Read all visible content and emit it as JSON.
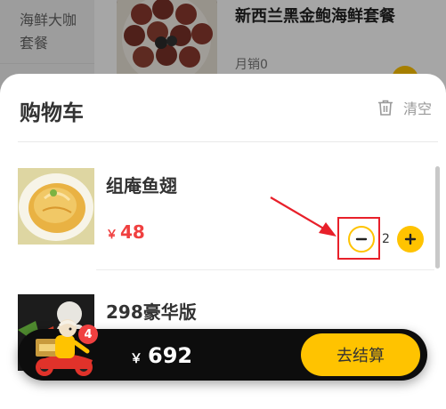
{
  "background_menu": {
    "category_line1": "海鲜大咖",
    "category_line2": "套餐",
    "product_title": "新西兰黑金鲍海鲜套餐",
    "product_sales": "月销0"
  },
  "cart": {
    "title": "购物车",
    "clear_label": "清空",
    "items": [
      {
        "name": "组庵鱼翅",
        "currency": "￥",
        "price": "48",
        "quantity": "2"
      },
      {
        "name": "298豪华版"
      }
    ]
  },
  "checkout": {
    "badge_count": "4",
    "currency": "￥",
    "total": "692",
    "button_label": "去结算"
  },
  "colors": {
    "accent": "#ffc300",
    "price": "#f04040",
    "highlight": "#e8202a",
    "bar": "#0d0d0d"
  },
  "icons": {
    "clear": "trash-icon",
    "decrease": "minus-icon",
    "increase": "plus-icon",
    "courier": "delivery-rider-icon"
  }
}
